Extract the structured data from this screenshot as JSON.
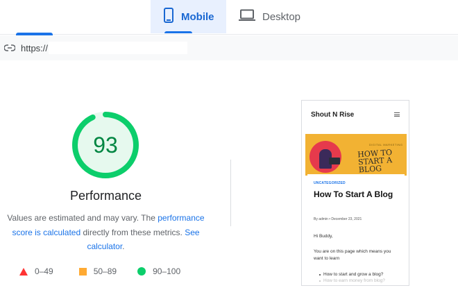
{
  "tabs": {
    "mobile": {
      "label": "Mobile",
      "icon": "smartphone-icon"
    },
    "desktop": {
      "label": "Desktop",
      "icon": "laptop-icon"
    }
  },
  "url_bar": {
    "icon": "link-icon",
    "url": "https://"
  },
  "score": {
    "value": "93",
    "fraction": 0.93,
    "color": "#0cce6b"
  },
  "performance": {
    "title": "Performance",
    "desc_part1": "Values are estimated and may vary. The ",
    "link1": "performance score is calculated",
    "desc_part2": " directly from these metrics. ",
    "link2": "See calculator",
    "desc_part3": "."
  },
  "legend": [
    {
      "range": "0–49",
      "color": "#ff3333",
      "shape": "triangle"
    },
    {
      "range": "50–89",
      "color": "#ffaa33",
      "shape": "square"
    },
    {
      "range": "90–100",
      "color": "#0cce6b",
      "shape": "circle"
    }
  ],
  "preview": {
    "site_name": "Shout N Rise",
    "hero_small": "DIGITAL MARKETING",
    "hero_text": "HOW TO START A BLOG",
    "category": "UNCATEGORIZED",
    "post_title": "How To Start A Blog",
    "meta": "By admin  •  December 23, 2021",
    "greeting": "Hi Buddy,",
    "body": "You are on this page which means you want to learn",
    "bullet1": "How to start and grow a blog?",
    "bullet2": "How to earn money from blog?"
  },
  "colors": {
    "accent": "#1a73e8",
    "pass": "#0cce6b",
    "average": "#ffaa33",
    "fail": "#ff3333"
  }
}
